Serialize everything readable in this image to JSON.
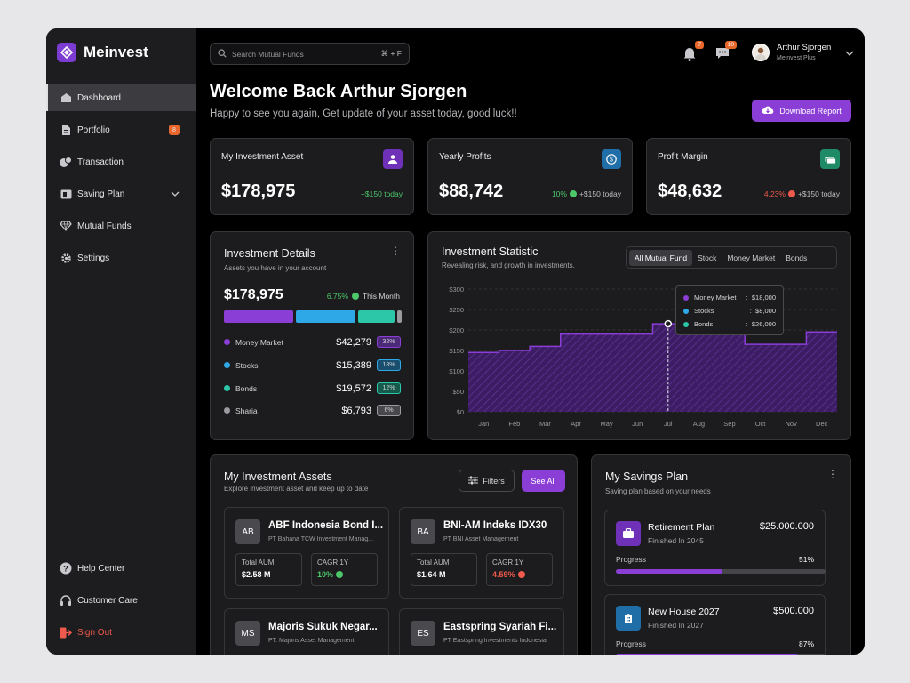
{
  "app": {
    "name": "Meinvest"
  },
  "sidebar": {
    "items": [
      {
        "label": "Dashboard",
        "icon": "home-icon"
      },
      {
        "label": "Portfolio",
        "icon": "document-icon",
        "badge": "8"
      },
      {
        "label": "Transaction",
        "icon": "transaction-icon"
      },
      {
        "label": "Saving Plan",
        "icon": "wallet-icon"
      },
      {
        "label": "Mutual Funds",
        "icon": "diamond-icon"
      },
      {
        "label": "Settings",
        "icon": "gear-icon"
      }
    ],
    "bottom": [
      {
        "label": "Help Center",
        "icon": "help-icon"
      },
      {
        "label": "Customer Care",
        "icon": "headset-icon"
      },
      {
        "label": "Sign Out",
        "icon": "sign-out-icon"
      }
    ]
  },
  "header": {
    "search_placeholder": "Search Mutual Funds",
    "search_shortcut": "⌘ + F",
    "notif_count": "7",
    "msg_count": "10",
    "user_name": "Arthur Sjorgen",
    "user_plan": "Meinvest Plus"
  },
  "welcome": {
    "title": "Welcome Back Arthur Sjorgen",
    "subtitle": "Happy to see you again, Get update of your asset today, good luck!!",
    "download_label": "Download Report"
  },
  "stats": [
    {
      "title": "My Investment Asset",
      "value": "$178,975",
      "delta": "+$150 today",
      "icon_color": "#6f31b8"
    },
    {
      "title": "Yearly Profits",
      "value": "$88,742",
      "pct": "10%",
      "delta": "+$150 today",
      "icon_color": "#1f6ea8"
    },
    {
      "title": "Profit Margin",
      "value": "$48,632",
      "pct": "4.23%",
      "delta": "+$150 today",
      "icon_color": "#1f8a66"
    }
  ],
  "details": {
    "title": "Investment Details",
    "subtitle": "Assets you have in your account",
    "total": "$178,975",
    "growth": "6.75%",
    "period": "This Month",
    "rows": [
      {
        "name": "Money Market",
        "value": "$42,279",
        "pct": "32%",
        "color": "#8a3ed6"
      },
      {
        "name": "Stocks",
        "value": "$15,389",
        "pct": "18%",
        "color": "#2fa8e8"
      },
      {
        "name": "Bonds",
        "value": "$19,572",
        "pct": "12%",
        "color": "#2cc7a8"
      },
      {
        "name": "Sharia",
        "value": "$6,793",
        "pct": "6%",
        "color": "#9b9b9f"
      }
    ]
  },
  "statistic": {
    "title": "Investment Statistic",
    "subtitle": "Revealing risk, and growth in investments.",
    "tabs": [
      "All Mutual Fund",
      "Stock",
      "Money Market",
      "Bonds"
    ],
    "tooltip": [
      {
        "label": "Money Market",
        "value": "$18,000",
        "color": "#8a3ed6"
      },
      {
        "label": "Stocks",
        "value": "$8,000",
        "color": "#2fa8e8"
      },
      {
        "label": "Bonds",
        "value": "$26,000",
        "color": "#2cc7a8"
      }
    ]
  },
  "chart_data": {
    "type": "area",
    "categories": [
      "Jan",
      "Feb",
      "Mar",
      "Apr",
      "May",
      "Jun",
      "Jul",
      "Aug",
      "Sep",
      "Oct",
      "Nov",
      "Dec"
    ],
    "values": [
      145,
      150,
      160,
      190,
      190,
      190,
      215,
      225,
      225,
      165,
      165,
      195
    ],
    "y_ticks": [
      "$0",
      "$50",
      "$100",
      "$150",
      "$200",
      "$250",
      "$300"
    ],
    "ylim": [
      0,
      300
    ],
    "highlight_category": "Jul",
    "color": "#8a3ed6"
  },
  "assets": {
    "title": "My Investment Assets",
    "subtitle": "Explore investment asset and keep up to date",
    "filter_label": "Filters",
    "see_all_label": "See All",
    "aum_label": "Total AUM",
    "cagr_label": "CAGR 1Y",
    "items": [
      {
        "abbr": "AB",
        "name": "ABF Indonesia Bond I...",
        "company": "PT Bahana TCW Investment Manag...",
        "aum": "$2.58 M",
        "cagr": "10%",
        "trend": "up"
      },
      {
        "abbr": "BA",
        "name": "BNI-AM Indeks IDX30",
        "company": "PT BNI Asset Management",
        "aum": "$1.64 M",
        "cagr": "4.59%",
        "trend": "down"
      },
      {
        "abbr": "MS",
        "name": "Majoris Sukuk Negar...",
        "company": "PT. Majoris Asset Management"
      },
      {
        "abbr": "ES",
        "name": "Eastspring Syariah Fi...",
        "company": "PT Eastspring Investments Indonesia"
      }
    ]
  },
  "savings": {
    "title": "My Savings Plan",
    "subtitle": "Saving plan based on your needs",
    "progress_label": "Progress",
    "plans": [
      {
        "name": "Retirement Plan",
        "finish": "Finished In 2045",
        "amount": "$25.000.000",
        "progress": "51%",
        "progress_value": 0.51,
        "icon_color": "#6f31b8"
      },
      {
        "name": "New House 2027",
        "finish": "Finished In 2027",
        "amount": "$500.000",
        "progress": "87%",
        "progress_value": 0.87,
        "icon_color": "#1f6ea8"
      }
    ]
  }
}
